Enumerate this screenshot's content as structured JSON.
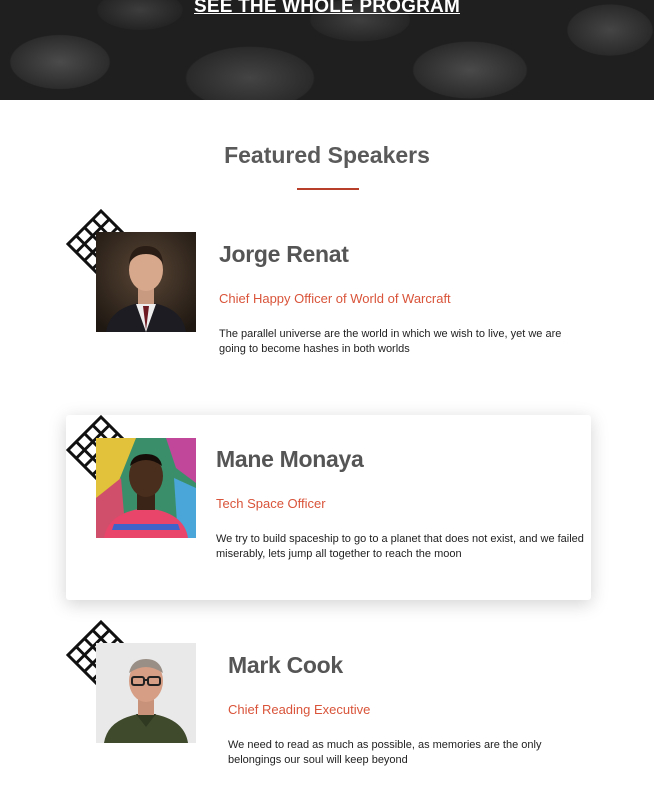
{
  "hero": {
    "link_label": "SEE THE WHOLE PROGRAM"
  },
  "section": {
    "title": "Featured Speakers",
    "accent_color": "#b8402a"
  },
  "speakers": [
    {
      "name": "Jorge Renat",
      "role": "Chief Happy Officer of World of Warcraft",
      "bio": "The parallel universe are the world in which we wish to live, yet we are going to become hashes in both worlds"
    },
    {
      "name": "Mane Monaya",
      "role": "Tech Space Officer",
      "bio": "We try to build spaceship to go to a planet that does not exist, and we failed miserably, lets jump all together to reach the moon"
    },
    {
      "name": "Mark Cook",
      "role": "Chief Reading Executive",
      "bio": "We need to read as much as possible, as memories are the only belongings our soul will keep beyond"
    }
  ]
}
